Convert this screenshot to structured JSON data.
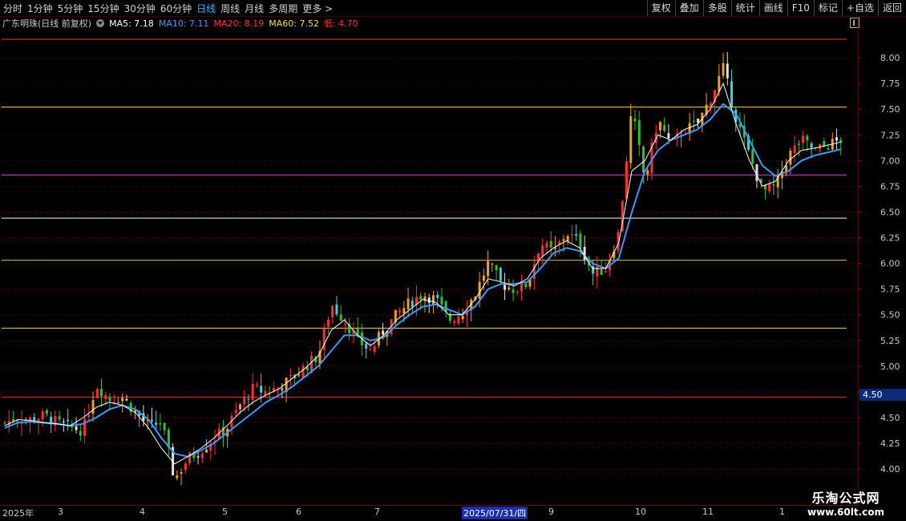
{
  "toolbar": {
    "tabs": [
      "分时",
      "1分钟",
      "5分钟",
      "15分钟",
      "30分钟",
      "60分钟",
      "日线",
      "周线",
      "月线",
      "多周期",
      "更多 >"
    ],
    "active_tab": "日线",
    "right_buttons": [
      "复权",
      "叠加",
      "多股",
      "统计",
      "画线",
      "F10",
      "标记",
      "+自选",
      "返回"
    ]
  },
  "info": {
    "title": "广东明珠(日线 前复权)",
    "ma5": "MA5: 7.18",
    "ma10": "MA10: 7.11",
    "ma20": "MA20: 8.19",
    "ma60": "MA60: 7.52",
    "low": "低: 4.70",
    "colors": {
      "title": "#c8c8c8",
      "ma5": "#ffffff",
      "ma10": "#3a9aff",
      "ma20": "#ff3030",
      "ma60": "#f0e040",
      "low": "#ff3030"
    }
  },
  "last_price_badge": "4.50",
  "dates": {
    "year_label": "2025年",
    "months": [
      "3",
      "4",
      "5",
      "6",
      "7",
      "9",
      "10",
      "11",
      "1"
    ],
    "selected": "2025/07/31/四"
  },
  "watermark": {
    "line1": "乐淘公式网",
    "line2": "www.60lt.com"
  },
  "chart_data": {
    "type": "candlestick",
    "title": "广东明珠(日线 前复权)",
    "ylim": [
      3.65,
      8.25
    ],
    "y_ticks": [
      4.0,
      4.25,
      4.5,
      4.75,
      5.0,
      5.25,
      5.5,
      5.75,
      6.0,
      6.25,
      6.5,
      6.75,
      7.0,
      7.25,
      7.5,
      7.75,
      8.0
    ],
    "horizontal_levels": [
      {
        "value": 8.18,
        "color": "#ff3030"
      },
      {
        "value": 7.52,
        "color": "#f0e040"
      },
      {
        "value": 6.86,
        "color": "#e040e0"
      },
      {
        "value": 6.44,
        "color": "#ffffff"
      },
      {
        "value": 6.03,
        "color": "#c0e040"
      },
      {
        "value": 5.37,
        "color": "#f0e040"
      },
      {
        "value": 4.7,
        "color": "#ff3030"
      }
    ],
    "close_path": [
      {
        "d": "2025-01",
        "v": 4.45
      },
      {
        "d": "2025-01",
        "v": 4.5
      },
      {
        "d": "2025-01",
        "v": 4.48
      },
      {
        "d": "2025-02",
        "v": 4.52
      },
      {
        "d": "2025-02",
        "v": 4.45
      },
      {
        "d": "2025-02",
        "v": 4.4
      },
      {
        "d": "2025-03",
        "v": 4.38
      },
      {
        "d": "2025-03",
        "v": 4.82
      },
      {
        "d": "2025-03",
        "v": 4.68
      },
      {
        "d": "2025-03",
        "v": 4.7
      },
      {
        "d": "2025-03",
        "v": 4.55
      },
      {
        "d": "2025-03",
        "v": 4.42
      },
      {
        "d": "2025-04",
        "v": 4.45
      },
      {
        "d": "2025-04",
        "v": 3.9
      },
      {
        "d": "2025-04",
        "v": 4.1
      },
      {
        "d": "2025-04",
        "v": 4.18
      },
      {
        "d": "2025-04",
        "v": 4.3
      },
      {
        "d": "2025-04",
        "v": 4.4
      },
      {
        "d": "2025-05",
        "v": 4.62
      },
      {
        "d": "2025-05",
        "v": 4.78
      },
      {
        "d": "2025-05",
        "v": 4.75
      },
      {
        "d": "2025-05",
        "v": 4.8
      },
      {
        "d": "2025-05",
        "v": 4.88
      },
      {
        "d": "2025-05",
        "v": 5.0
      },
      {
        "d": "2025-06",
        "v": 5.1
      },
      {
        "d": "2025-06",
        "v": 5.6
      },
      {
        "d": "2025-06",
        "v": 5.45
      },
      {
        "d": "2025-06",
        "v": 5.25
      },
      {
        "d": "2025-06",
        "v": 5.15
      },
      {
        "d": "2025-06",
        "v": 5.35
      },
      {
        "d": "2025-07",
        "v": 5.5
      },
      {
        "d": "2025-07",
        "v": 5.62
      },
      {
        "d": "2025-07",
        "v": 5.7
      },
      {
        "d": "2025-07",
        "v": 5.65
      },
      {
        "d": "2025-07",
        "v": 5.45
      },
      {
        "d": "2025-07",
        "v": 5.52
      },
      {
        "d": "2025-08",
        "v": 5.7
      },
      {
        "d": "2025-08",
        "v": 6.0
      },
      {
        "d": "2025-08",
        "v": 5.8
      },
      {
        "d": "2025-08",
        "v": 5.75
      },
      {
        "d": "2025-08",
        "v": 5.8
      },
      {
        "d": "2025-09",
        "v": 6.2
      },
      {
        "d": "2025-09",
        "v": 6.1
      },
      {
        "d": "2025-09",
        "v": 6.3
      },
      {
        "d": "2025-09",
        "v": 6.2
      },
      {
        "d": "2025-09",
        "v": 5.9
      },
      {
        "d": "2025-09",
        "v": 5.95
      },
      {
        "d": "2025-10",
        "v": 6.3
      },
      {
        "d": "2025-10",
        "v": 7.5
      },
      {
        "d": "2025-10",
        "v": 6.8
      },
      {
        "d": "2025-10",
        "v": 7.4
      },
      {
        "d": "2025-10",
        "v": 7.15
      },
      {
        "d": "2025-10",
        "v": 7.3
      },
      {
        "d": "2025-11",
        "v": 7.35
      },
      {
        "d": "2025-11",
        "v": 7.6
      },
      {
        "d": "2025-11",
        "v": 7.9
      },
      {
        "d": "2025-11",
        "v": 7.4
      },
      {
        "d": "2025-11",
        "v": 7.05
      },
      {
        "d": "2025-12",
        "v": 6.7
      },
      {
        "d": "2025-12",
        "v": 6.75
      },
      {
        "d": "2025-12",
        "v": 7.05
      },
      {
        "d": "2025-12",
        "v": 7.2
      },
      {
        "d": "2026-01",
        "v": 7.1
      },
      {
        "d": "2026-01",
        "v": 7.15
      },
      {
        "d": "2026-01",
        "v": 7.2
      }
    ],
    "ma5": [
      4.42,
      4.48,
      4.47,
      4.45,
      4.44,
      4.42,
      4.5,
      4.6,
      4.65,
      4.62,
      4.55,
      4.4,
      4.2,
      4.05,
      4.12,
      4.2,
      4.3,
      4.42,
      4.55,
      4.65,
      4.72,
      4.78,
      4.88,
      4.98,
      5.1,
      5.35,
      5.45,
      5.3,
      5.2,
      5.3,
      5.45,
      5.55,
      5.65,
      5.62,
      5.5,
      5.5,
      5.65,
      5.85,
      5.82,
      5.78,
      5.85,
      6.05,
      6.15,
      6.22,
      6.15,
      5.95,
      5.95,
      6.2,
      6.9,
      7.0,
      7.25,
      7.2,
      7.3,
      7.35,
      7.5,
      7.75,
      7.35,
      7.0,
      6.75,
      6.8,
      7.0,
      7.1,
      7.12,
      7.15,
      7.18
    ],
    "ma10": [
      4.4,
      4.45,
      4.46,
      4.45,
      4.44,
      4.42,
      4.44,
      4.5,
      4.58,
      4.62,
      4.58,
      4.48,
      4.3,
      4.15,
      4.12,
      4.18,
      4.25,
      4.35,
      4.45,
      4.55,
      4.65,
      4.72,
      4.8,
      4.9,
      5.0,
      5.15,
      5.3,
      5.3,
      5.25,
      5.28,
      5.4,
      5.5,
      5.58,
      5.6,
      5.55,
      5.5,
      5.58,
      5.75,
      5.8,
      5.8,
      5.82,
      5.95,
      6.1,
      6.15,
      6.12,
      6.0,
      5.95,
      6.05,
      6.5,
      6.9,
      7.1,
      7.2,
      7.25,
      7.3,
      7.4,
      7.55,
      7.45,
      7.2,
      6.95,
      6.85,
      6.9,
      7.0,
      7.05,
      7.08,
      7.11
    ]
  }
}
